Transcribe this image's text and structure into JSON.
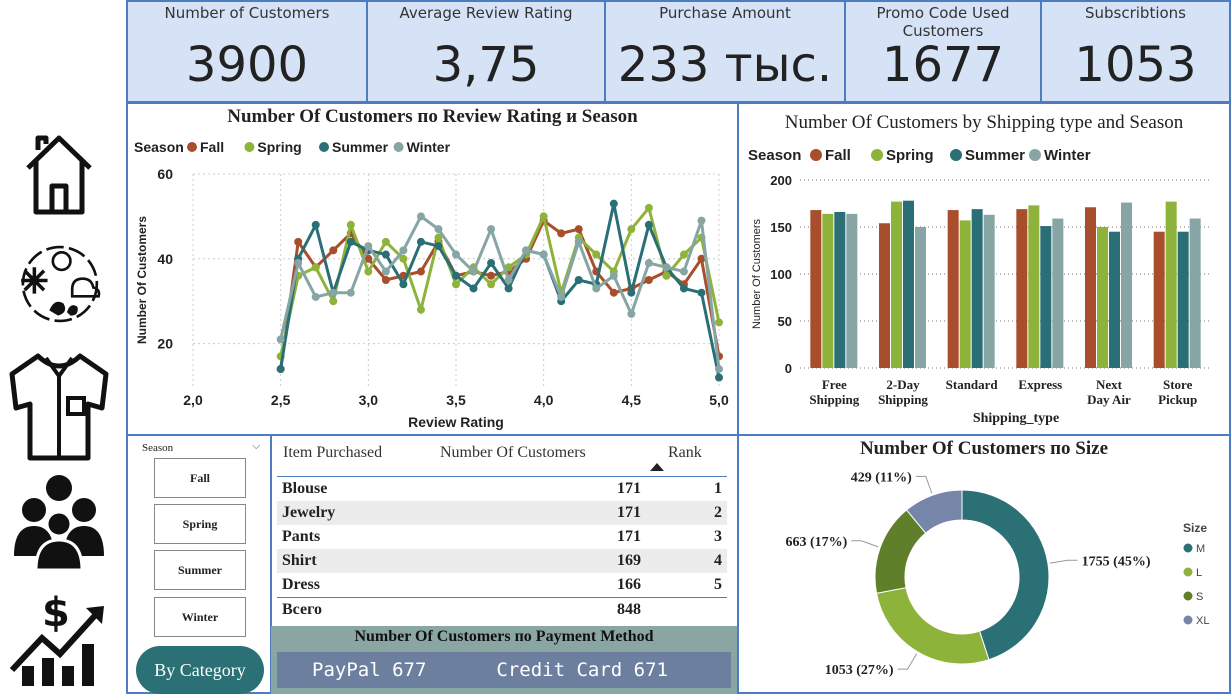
{
  "kpis": [
    {
      "label": "Number of Customers",
      "value": "3900"
    },
    {
      "label": "Average Review Rating",
      "value": "3,75"
    },
    {
      "label": "Purchase Amount",
      "value": "233 тыс."
    },
    {
      "label": "Promo Code Used Customers",
      "value": "1677"
    },
    {
      "label": "Subscribtions",
      "value": "1053"
    }
  ],
  "nav_icons": [
    "home-icon",
    "weather-icon",
    "shirt-icon",
    "people-icon",
    "growth-chart-icon"
  ],
  "line_panel": {
    "title": "Number Of Customers по Review Rating и Season"
  },
  "bar_panel": {
    "title": "Number Of Customers by Shipping type and Season"
  },
  "donut_panel": {
    "title": "Number Of Customers по Size"
  },
  "slicer": {
    "header": "Season",
    "items": [
      "Fall",
      "Spring",
      "Summer",
      "Winter"
    ],
    "category_button": "By Category"
  },
  "table": {
    "headers": [
      "Item Purchased",
      "Number Of Customers",
      "Rank"
    ],
    "rows": [
      {
        "item": "Blouse",
        "customers": "171",
        "rank": "1"
      },
      {
        "item": "Jewelry",
        "customers": "171",
        "rank": "2"
      },
      {
        "item": "Pants",
        "customers": "171",
        "rank": "3"
      },
      {
        "item": "Shirt",
        "customers": "169",
        "rank": "4"
      },
      {
        "item": "Dress",
        "customers": "166",
        "rank": "5"
      }
    ],
    "total_label": "Всего",
    "total_value": "848"
  },
  "payment": {
    "title": "Number Of Customers по Payment Method",
    "paypal": "PayPal 677",
    "credit": "Credit Card 671"
  },
  "colors": {
    "Fall": "#a84e2c",
    "Spring": "#8db33a",
    "Summer": "#2a6f76",
    "Winter": "#86a5a4",
    "M": "#2b7074",
    "L": "#8db33a",
    "S": "#5f7f2a",
    "XL": "#7686a8"
  },
  "chart_data": [
    {
      "type": "line",
      "title": "Number Of Customers по Review Rating и Season",
      "xlabel": "Review Rating",
      "ylabel": "Number Of Customers",
      "legend_title": "Season",
      "legend_position": "top-left",
      "xlim": [
        2.0,
        5.0
      ],
      "ylim": [
        10,
        60
      ],
      "x_ticks": [
        "2,0",
        "2,5",
        "3,0",
        "3,5",
        "4,0",
        "4,5",
        "5,0"
      ],
      "y_ticks": [
        "20",
        "40",
        "60"
      ],
      "x": [
        2.5,
        2.6,
        2.7,
        2.8,
        2.9,
        3.0,
        3.1,
        3.2,
        3.3,
        3.4,
        3.5,
        3.6,
        3.7,
        3.8,
        3.9,
        4.0,
        4.1,
        4.2,
        4.3,
        4.4,
        4.5,
        4.6,
        4.7,
        4.8,
        4.9,
        5.0
      ],
      "series": [
        {
          "name": "Fall",
          "values": [
            14,
            44,
            38,
            42,
            46,
            40,
            35,
            36,
            37,
            44,
            36,
            37,
            36,
            37,
            40,
            49,
            46,
            47,
            37,
            32,
            33,
            35,
            37,
            34,
            40,
            17
          ]
        },
        {
          "name": "Spring",
          "values": [
            17,
            36,
            38,
            30,
            48,
            37,
            44,
            40,
            28,
            45,
            34,
            38,
            34,
            38,
            41,
            50,
            32,
            45,
            41,
            37,
            47,
            52,
            36,
            41,
            45,
            25
          ]
        },
        {
          "name": "Summer",
          "values": [
            14,
            40,
            48,
            32,
            44,
            42,
            41,
            34,
            44,
            43,
            36,
            33,
            39,
            33,
            42,
            41,
            30,
            35,
            34,
            53,
            32,
            48,
            38,
            33,
            32,
            12
          ]
        },
        {
          "name": "Winter",
          "values": [
            21,
            39,
            31,
            32,
            32,
            43,
            37,
            42,
            50,
            47,
            41,
            37,
            47,
            35,
            42,
            41,
            31,
            44,
            33,
            36,
            27,
            39,
            38,
            37,
            49,
            14
          ]
        }
      ]
    },
    {
      "type": "bar",
      "title": "Number Of Customers by Shipping type and Season",
      "xlabel": "Shipping_type",
      "ylabel": "Number Of Customers",
      "legend_title": "Season",
      "legend_position": "top-left",
      "ylim": [
        0,
        200
      ],
      "y_ticks": [
        "0",
        "50",
        "100",
        "150",
        "200"
      ],
      "categories": [
        "Free Shipping",
        "2-Day Shipping",
        "Standard",
        "Express",
        "Next Day Air",
        "Store Pickup"
      ],
      "series": [
        {
          "name": "Fall",
          "values": [
            168,
            154,
            168,
            169,
            171,
            145
          ]
        },
        {
          "name": "Spring",
          "values": [
            164,
            177,
            157,
            173,
            150,
            177
          ]
        },
        {
          "name": "Summer",
          "values": [
            166,
            178,
            169,
            151,
            145,
            145
          ]
        },
        {
          "name": "Winter",
          "values": [
            164,
            150,
            163,
            159,
            176,
            159
          ]
        }
      ]
    },
    {
      "type": "pie",
      "title": "Number Of Customers по Size",
      "legend_title": "Size",
      "legend_position": "right",
      "slices": [
        {
          "name": "M",
          "value": 1755,
          "label": "1755 (45%)"
        },
        {
          "name": "L",
          "value": 1053,
          "label": "1053 (27%)"
        },
        {
          "name": "S",
          "value": 663,
          "label": "663 (17%)"
        },
        {
          "name": "XL",
          "value": 429,
          "label": "429 (11%)"
        }
      ]
    }
  ]
}
